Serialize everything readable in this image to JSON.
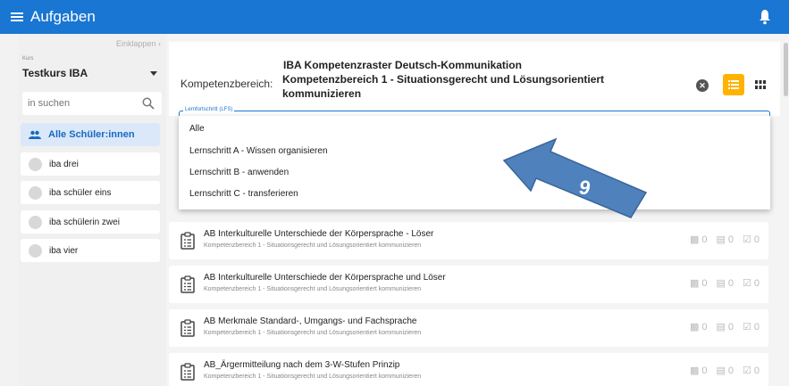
{
  "topbar": {
    "menu_icon": "hamburger-icon",
    "title": "Aufgaben",
    "bell_icon": "bell-icon"
  },
  "sidebar": {
    "collapse_label": "Einklappen",
    "course_label": "Kurs",
    "course_value": "Testkurs IBA",
    "search_placeholder": "in suchen",
    "students": [
      {
        "label": "Alle Schüler:innen",
        "active": true
      },
      {
        "label": "iba drei"
      },
      {
        "label": "iba schüler eins"
      },
      {
        "label": "iba schülerin zwei"
      },
      {
        "label": "iba vier"
      }
    ]
  },
  "header": {
    "kb_label": "Kompetenzbereich:",
    "kb_title_line1": "IBA Kompetenzraster Deutsch-Kommunikation",
    "kb_title_line2": "Kompetenzbereich 1 - Situationsgerecht und Lösungsorientiert",
    "kb_title_line3": "kommunizieren",
    "field_label": "Lernfortschritt (LFS)"
  },
  "dropdown": {
    "options": [
      "Alle",
      "Lernschritt A - Wissen organisieren",
      "Lernschritt B - anwenden",
      "Lernschritt C - transferieren"
    ]
  },
  "annotation": {
    "number": "9",
    "color": "#4f81bd"
  },
  "cards": [
    {
      "title": "AB Interkulturelle Unterschiede der Körpersprache - Löser",
      "subtitle": "Kompetenzbereich 1 - Situationsgerecht und Lösungsorientiert kommunizieren",
      "s1": "0",
      "s2": "0",
      "s3": "0"
    },
    {
      "title": "AB Interkulturelle Unterschiede der Körpersprache und Löser",
      "subtitle": "Kompetenzbereich 1 - Situationsgerecht und Lösungsorientiert kommunizieren",
      "s1": "0",
      "s2": "0",
      "s3": "0"
    },
    {
      "title": "AB Merkmale Standard-, Umgangs- und Fachsprache",
      "subtitle": "Kompetenzbereich 1 - Situationsgerecht und Lösungsorientiert kommunizieren",
      "s1": "0",
      "s2": "0",
      "s3": "0"
    },
    {
      "title": "AB_Ärgermitteilung nach dem 3-W-Stufen Prinzip",
      "subtitle": "Kompetenzbereich 1 - Situationsgerecht und Lösungsorientiert kommunizieren",
      "s1": "0",
      "s2": "0",
      "s3": "0"
    }
  ],
  "colors": {
    "primary": "#1976d2",
    "accent": "#ffb300",
    "active_bg": "#dbe8f9"
  }
}
